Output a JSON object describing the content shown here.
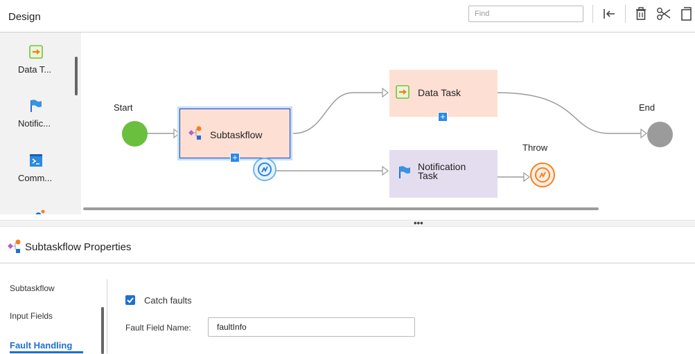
{
  "header": {
    "title": "Design",
    "find_placeholder": "Find",
    "toolbar": [
      {
        "icon": "collapse-left-icon"
      },
      {
        "icon": "trash-icon"
      },
      {
        "icon": "scissors-icon"
      },
      {
        "icon": "copy-icon"
      }
    ]
  },
  "palette": {
    "items": [
      {
        "label": "Data T...",
        "icon": "data-task-icon"
      },
      {
        "label": "Notific...",
        "icon": "flag-icon"
      },
      {
        "label": "Comm...",
        "icon": "command-icon"
      }
    ]
  },
  "canvas": {
    "start_label": "Start",
    "end_label": "End",
    "throw_label": "Throw",
    "subtaskflow_label": "Subtaskflow",
    "data_task_label": "Data Task",
    "notification_line1": "Notification",
    "notification_line2": "Task"
  },
  "properties": {
    "title": "Subtaskflow Properties",
    "tabs": [
      "Subtaskflow",
      "Input Fields",
      "Fault Handling"
    ],
    "active_tab": "Fault Handling",
    "catch_faults_label": "Catch faults",
    "catch_faults_checked": true,
    "fault_field_label": "Fault Field Name:",
    "fault_field_value": "faultInfo"
  },
  "colors": {
    "accent": "#1d6fd6",
    "start": "#6abf3f",
    "end": "#9b9b9b",
    "throw": "#f57f20",
    "subtask_fill": "#fde0d3",
    "data_task_fill": "#fde0d3",
    "notification_fill": "#e4ddef"
  }
}
